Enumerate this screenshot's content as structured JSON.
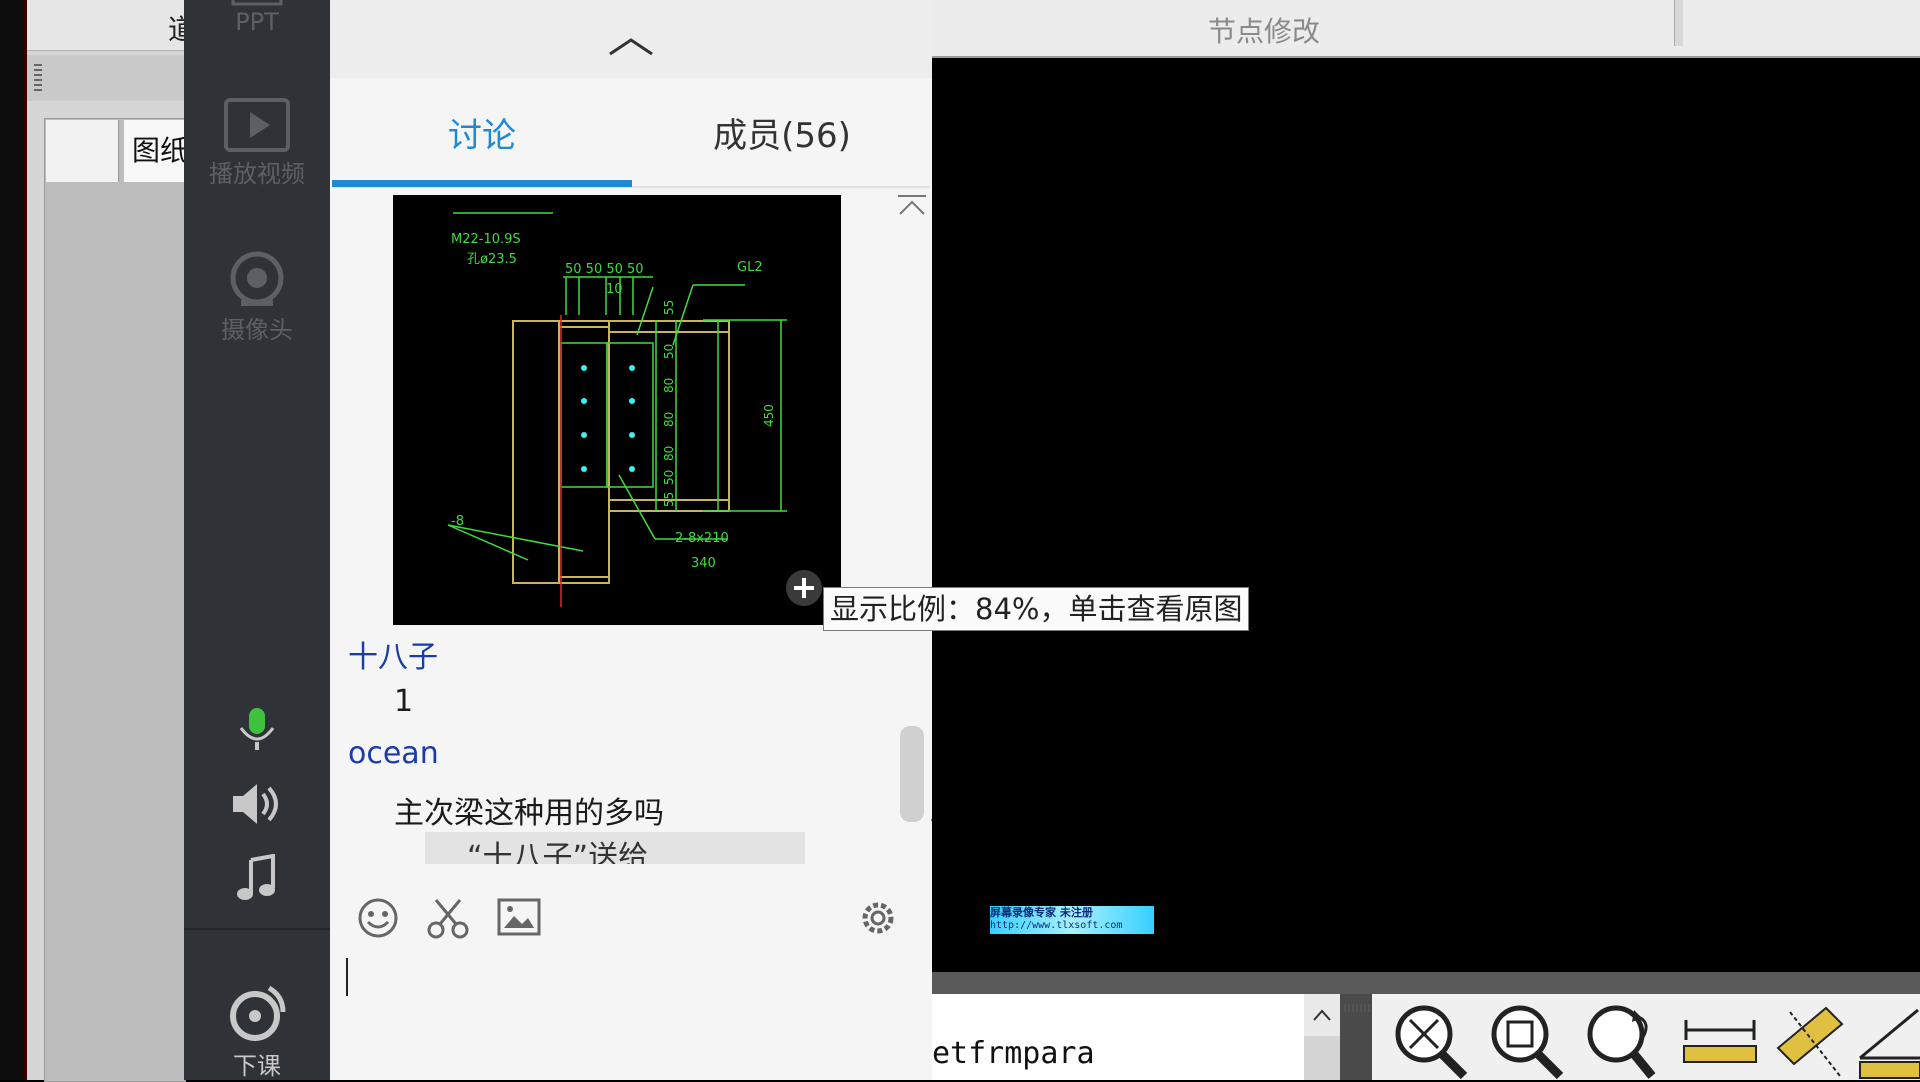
{
  "left_app": {
    "tab_label": "图纸",
    "top_label": "道"
  },
  "sidebar": {
    "items": [
      {
        "label": "PPT",
        "icon": "ppt-icon"
      },
      {
        "label": "播放视频",
        "icon": "play-video-icon"
      },
      {
        "label": "摄像头",
        "icon": "camera-icon"
      },
      {
        "label": "",
        "icon": "microphone-icon"
      },
      {
        "label": "",
        "icon": "speaker-icon"
      },
      {
        "label": "",
        "icon": "music-icon"
      },
      {
        "label": "下课",
        "icon": "power-icon"
      }
    ]
  },
  "chat": {
    "tabs": [
      {
        "label": "讨论",
        "active": true
      },
      {
        "label": "成员(56)",
        "active": false
      }
    ],
    "messages": [
      {
        "name": "十八子",
        "text": "1"
      },
      {
        "name": "ocean",
        "text": "主次梁这种用的多吗"
      }
    ],
    "quote_preview": "“十八子”送给",
    "tools": [
      "emoji-icon",
      "scissors-icon",
      "image-icon",
      "settings-icon"
    ],
    "accent_color": "#1e8ad6"
  },
  "cad_image": {
    "labels": {
      "bolt": "M22-10.9S",
      "hole": "孔ø23.5",
      "dims_top": "50 50  50 50",
      "gap": "10",
      "beam": "GL2",
      "plate": "-8",
      "stiffener": "2-8x210",
      "length": "340",
      "height": "450",
      "v55a": "55",
      "v50a": "50",
      "v80a": "80",
      "v80b": "80",
      "v80c": "80",
      "v50b": "50",
      "v55b": "55"
    }
  },
  "tooltip": {
    "text": "显示比例：84%，单击查看原图"
  },
  "right_area": {
    "header_label": "节点修改",
    "command_text": "etfrmpara",
    "watermark_line1": "屏幕录像专家    未注册",
    "watermark_line2": "http://www.tlxsoft.com",
    "tools": [
      "zoom-extents-icon",
      "zoom-window-icon",
      "zoom-previous-icon",
      "dimension-icon",
      "measure-icon",
      "angle-icon"
    ]
  }
}
